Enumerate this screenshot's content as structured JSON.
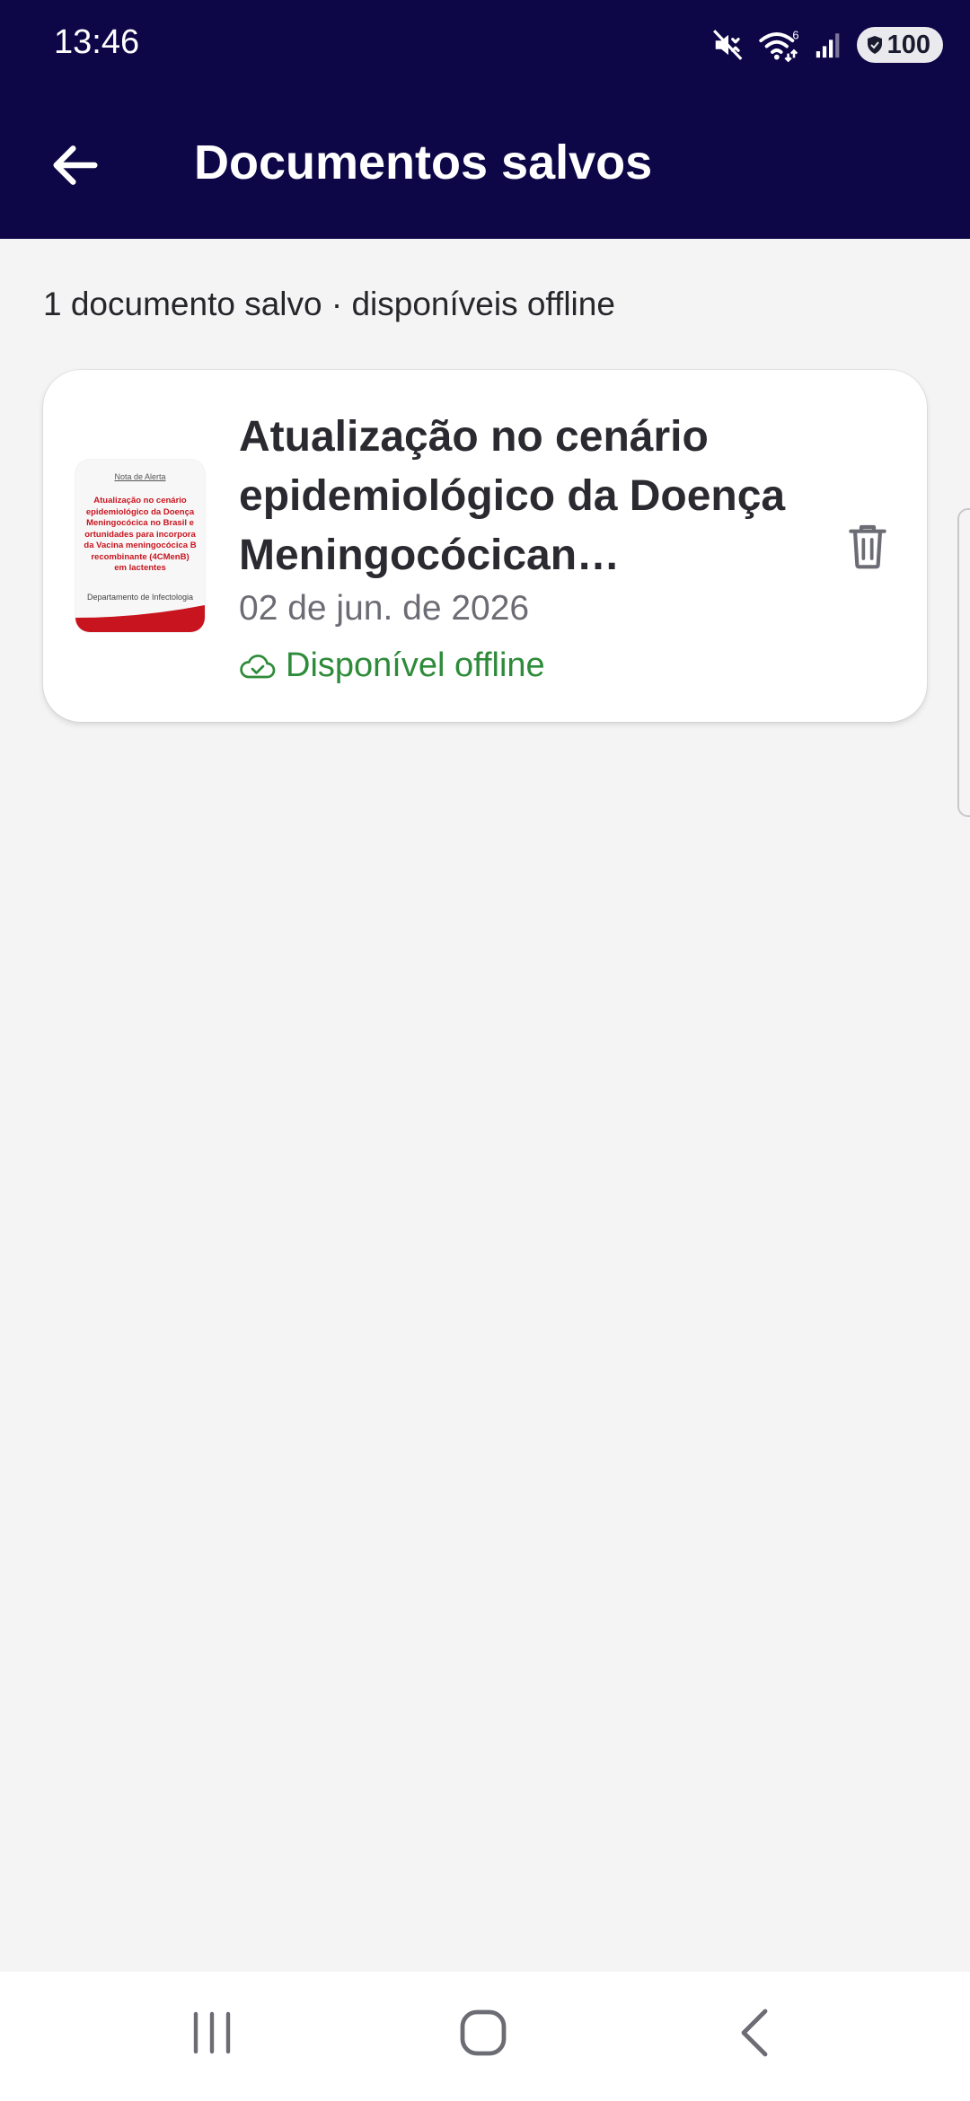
{
  "status_bar": {
    "time": "13:46",
    "battery": "100",
    "wifi_badge": "6"
  },
  "header": {
    "title": "Documentos salvos",
    "back_icon": "arrow-left-icon"
  },
  "summary": {
    "text": "1 documento salvo · disponíveis offline"
  },
  "documents": [
    {
      "title": "Atualização no cenário epidemiológico da Doença Meningocócican…",
      "date": "02 de jun. de 2026",
      "status": "Disponível offline",
      "status_icon": "cloud-check-icon",
      "action_icon": "trash-icon",
      "thumbnail": {
        "label": "Nota de Alerta",
        "body": "Atualização no cenário\nepidemiológico da Doença\nMeningocócica no Brasil e\nortunidades para incorpora\nda Vacina meningocócica B\nrecombinante (4CMenB)\nem lactentes",
        "department": "Departamento de Infectologia"
      }
    }
  ],
  "colors": {
    "header_bg": "#0D0747",
    "page_bg": "#F4F4F5",
    "offline_green": "#2E8B3A",
    "thumb_red": "#C8141E"
  },
  "nav": {
    "recents_icon": "recents-icon",
    "home_icon": "home-icon",
    "back_icon": "back-chevron-icon"
  }
}
